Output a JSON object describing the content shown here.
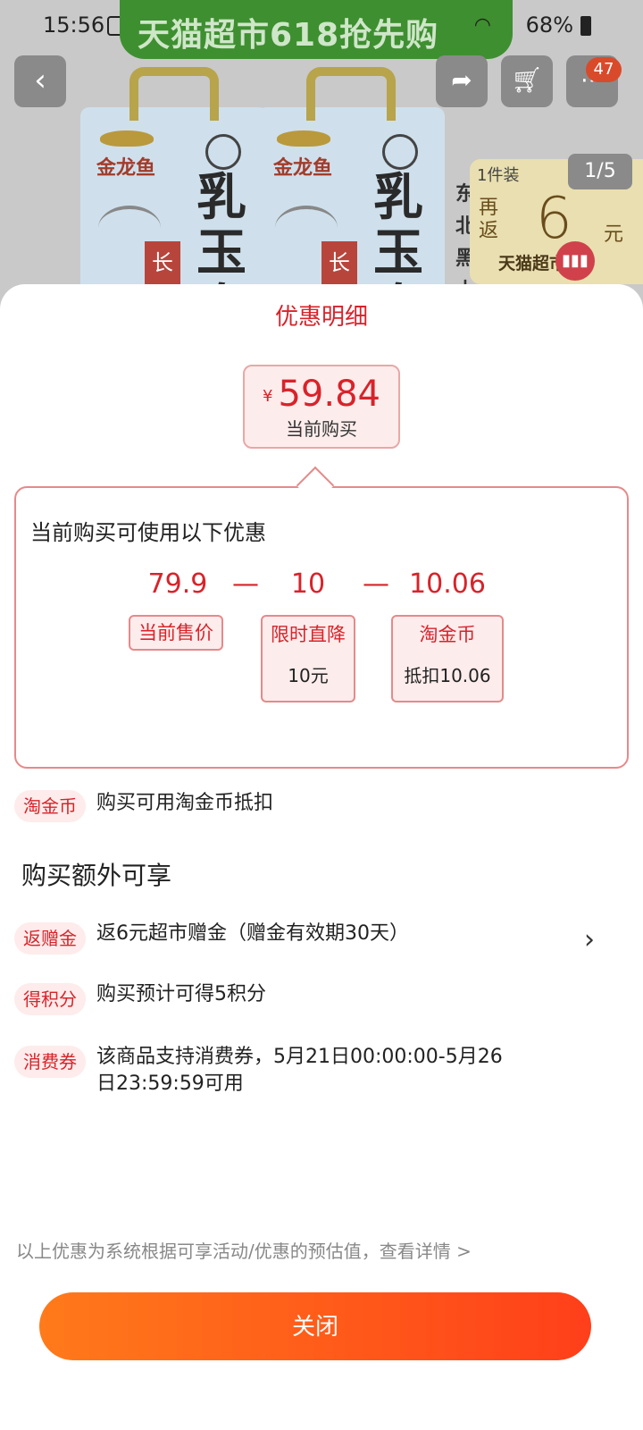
{
  "status_bar": {
    "time": "15:56",
    "battery": "68%",
    "banner_text": "天猫超市618抢先购"
  },
  "product_bg": {
    "brand": "金龙鱼",
    "big_text": "乳玉皇",
    "red_label": "长",
    "side_text": "东北黑土",
    "cart_badge": "47",
    "pager": "1/5",
    "promo_card": {
      "top": "1件装",
      "return_label": "再返",
      "amount": "6",
      "unit": "元",
      "bottom": "天猫超市"
    }
  },
  "sheet": {
    "title": "优惠明细",
    "price": {
      "currency": "¥",
      "value": "59.84",
      "label": "当前购买"
    },
    "detail": {
      "title": "当前购买可使用以下优惠",
      "items": [
        {
          "value": "79.9",
          "label": "当前售价",
          "sub": ""
        },
        {
          "value": "10",
          "label": "限时直降",
          "sub": "10元"
        },
        {
          "value": "10.06",
          "label": "淘金币",
          "sub": "抵扣10.06"
        }
      ],
      "operator": "—"
    },
    "coin_row": {
      "tag": "淘金币",
      "text": "购买可用淘金币抵扣"
    },
    "extra_heading": "购买额外可享",
    "extras": [
      {
        "tag": "返赠金",
        "text": "返6元超市赠金（赠金有效期30天）"
      },
      {
        "tag": "得积分",
        "text": "购买预计可得5积分"
      },
      {
        "tag": "消费券",
        "text": "该商品支持消费券，5月21日00:00:00-5月26日23:59:59可用"
      }
    ],
    "footnote": "以上优惠为系统根据可享活动/优惠的预估值，查看详情 >",
    "close_label": "关闭"
  },
  "colors": {
    "accent_red": "#d8232a",
    "button_start": "#ff7a1a",
    "button_end": "#ff3f1a"
  }
}
